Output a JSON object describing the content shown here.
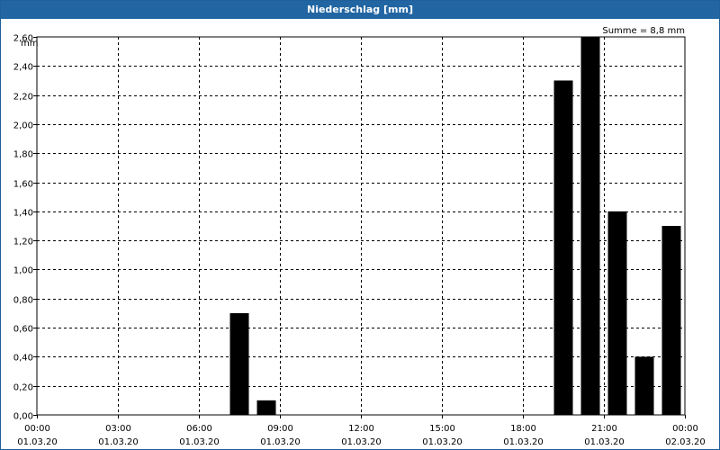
{
  "window": {
    "title": "Niederschlag [mm]"
  },
  "chart_data": {
    "type": "bar",
    "title": "Niederschlag [mm]",
    "ylabel": "mm",
    "xlabel": "",
    "annotation": "Summe = 8,8 mm",
    "ylim": [
      0,
      2.6
    ],
    "y_ticks": [
      "0,00",
      "0,20",
      "0,40",
      "0,60",
      "0,80",
      "1,00",
      "1,20",
      "1,40",
      "1,60",
      "1,80",
      "2,00",
      "2,20",
      "2,40",
      "2,60"
    ],
    "x_range_hours": [
      0,
      24
    ],
    "x_ticks": [
      {
        "time": "00:00",
        "date": "01.03.20"
      },
      {
        "time": "03:00",
        "date": "01.03.20"
      },
      {
        "time": "06:00",
        "date": "01.03.20"
      },
      {
        "time": "09:00",
        "date": "01.03.20"
      },
      {
        "time": "12:00",
        "date": "01.03.20"
      },
      {
        "time": "15:00",
        "date": "01.03.20"
      },
      {
        "time": "18:00",
        "date": "01.03.20"
      },
      {
        "time": "21:00",
        "date": "01.03.20"
      },
      {
        "time": "00:00",
        "date": "02.03.20"
      }
    ],
    "bars": [
      {
        "hour": 7.5,
        "value": 0.7
      },
      {
        "hour": 8.5,
        "value": 0.1
      },
      {
        "hour": 19.5,
        "value": 2.3
      },
      {
        "hour": 20.5,
        "value": 2.6
      },
      {
        "hour": 21.5,
        "value": 1.4
      },
      {
        "hour": 22.5,
        "value": 0.4
      },
      {
        "hour": 23.5,
        "value": 1.3
      }
    ],
    "grid": true,
    "bar_color": "#000000"
  }
}
